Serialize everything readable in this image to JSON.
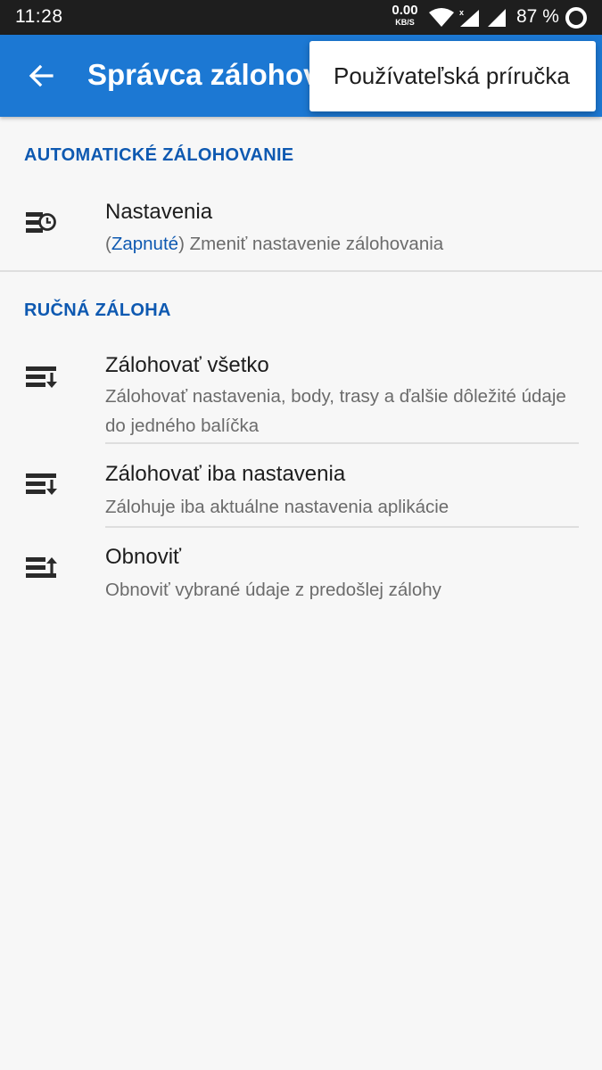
{
  "status_bar": {
    "time": "11:28",
    "net_speed_value": "0.00",
    "net_speed_unit": "KB/S",
    "signal_label": "x",
    "battery_percent": "87 %"
  },
  "app_bar": {
    "title": "Správca zálohovania",
    "color": "#1c78d3"
  },
  "overflow_menu": {
    "items": [
      {
        "label": "Používateľská príručka"
      }
    ]
  },
  "sections": [
    {
      "header": "AUTOMATICKÉ ZÁLOHOVANIE",
      "items": [
        {
          "title": "Nastavenia",
          "status_open": "(",
          "status": "Zapnuté",
          "status_close": ")",
          "subtitle": " Zmeniť nastavenie zálohovania",
          "icon": "backup-schedule-icon"
        }
      ]
    },
    {
      "header": "RUČNÁ ZÁLOHA",
      "items": [
        {
          "title": "Zálohovať všetko",
          "subtitle": "Zálohovať nastavenia, body, trasy a ďalšie dôležité údaje do jedného balíčka",
          "icon": "backup-download-icon"
        },
        {
          "title": "Zálohovať iba nastavenia",
          "subtitle": "Zálohuje iba aktuálne nastavenia aplikácie",
          "icon": "backup-download-icon"
        },
        {
          "title": "Obnoviť",
          "subtitle": "Obnoviť vybrané údaje z predošlej zálohy",
          "icon": "restore-upload-icon"
        }
      ]
    }
  ],
  "colors": {
    "accent": "#0e59b1",
    "background": "#f7f7f7",
    "text_primary": "#1d1d1d",
    "text_secondary": "#6b6b6b"
  }
}
